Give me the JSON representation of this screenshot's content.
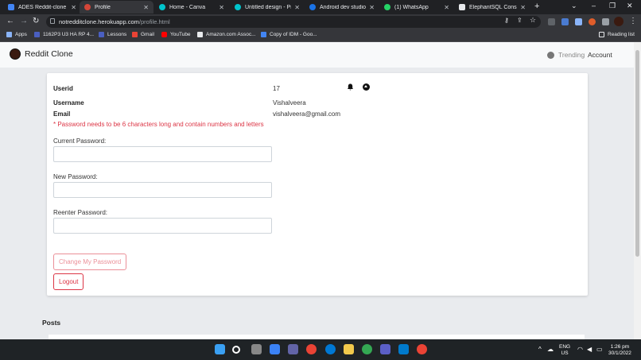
{
  "browser": {
    "tabs": [
      {
        "label": "ADES Reddit-clone C",
        "active": false,
        "color": "#4285f4"
      },
      {
        "label": "Profile",
        "active": true,
        "color": "#d44638"
      },
      {
        "label": "Home - Canva",
        "active": false,
        "color": "#00c4cc"
      },
      {
        "label": "Untitled design - Pres",
        "active": false,
        "color": "#00c4cc"
      },
      {
        "label": "Android dev studio w",
        "active": false,
        "color": "#1a73e8"
      },
      {
        "label": "(1) WhatsApp",
        "active": false,
        "color": "#25d366"
      },
      {
        "label": "ElephantSQL Console",
        "active": false,
        "color": "#e8eaed"
      }
    ],
    "url_host": "notredditclone.herokuapp.com",
    "url_path": "/profile.html",
    "bookmarks": [
      {
        "label": "Apps",
        "icon": "apps-grid-icon"
      },
      {
        "label": "1162P3 U3 HA RP 4...",
        "icon": "bookmark-icon"
      },
      {
        "label": "Lessons",
        "icon": "bookmark-icon"
      },
      {
        "label": "Gmail",
        "icon": "gmail-icon"
      },
      {
        "label": "YouTube",
        "icon": "youtube-icon"
      },
      {
        "label": "Amazon.com Assoc...",
        "icon": "amazon-icon"
      },
      {
        "label": "Copy of IDM - Goo...",
        "icon": "docs-icon"
      }
    ],
    "reading_list": "Reading list"
  },
  "navbar": {
    "brand": "Reddit Clone",
    "trending": "Trending",
    "account": "Account"
  },
  "profile": {
    "userid_label": "Userid",
    "userid_value": "17",
    "username_label": "Username",
    "username_value": "Vishalveera",
    "email_label": "Email",
    "email_value": "vishalveera@gmail.com",
    "warning": "* Password needs to be 6 characters long and contain numbers and letters",
    "current_password_label": "Current Password:",
    "new_password_label": "New Password:",
    "reenter_password_label": "Reenter Password:",
    "change_button": "Change My Password",
    "logout_button": "Logout"
  },
  "posts": {
    "title": "Posts"
  },
  "taskbar": {
    "lang": "ENG",
    "region": "US",
    "time": "1:26 pm",
    "date": "30/1/2022"
  }
}
